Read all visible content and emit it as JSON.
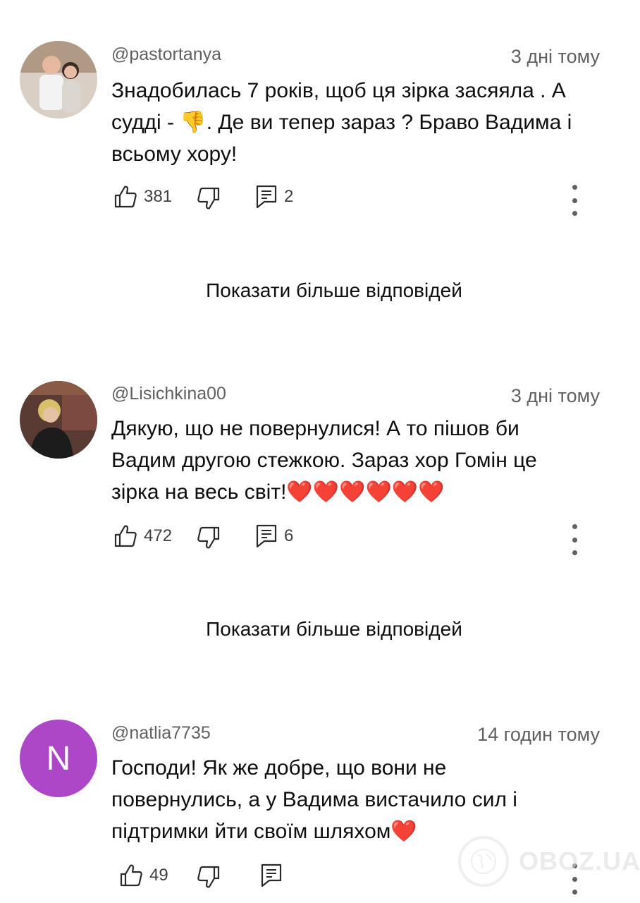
{
  "comments": [
    {
      "handle": "@pastortanya",
      "time": "3 дні тому",
      "lines": [
        "Знадобилась 7 років, щоб ця зірка засяяла . А",
        "судді - 👎. Де ви тепер зараз ? Браво Вадима і",
        "всьому хору!"
      ],
      "likes": "381",
      "replies": "2",
      "avatar": "photo"
    },
    {
      "handle": "@Lisichkina00",
      "time": "3 дні тому",
      "lines": [
        "Дякую, що не повернулися! А то пішов би",
        "Вадим другою стежкою. Зараз хор Гомін це",
        "зірка на весь світ!❤️❤️❤️❤️❤️❤️"
      ],
      "likes": "472",
      "replies": "6",
      "avatar": "photo"
    },
    {
      "handle": "@natlia7735",
      "time": "14 годин тому",
      "lines": [
        "Господи! Як же добре, що вони не",
        "повернулись, а у Вадима вистачило сил і",
        "підтримки йти своїм шляхом❤️"
      ],
      "likes": "49",
      "replies": "",
      "avatar_letter": "N"
    }
  ],
  "show_more_label": "Показати більше відповідей",
  "watermark": "OBOZ.UA",
  "colors": {
    "letter_avatar": "#ad46c7",
    "secondary_text": "#606060"
  },
  "icons": [
    "thumb-up-icon",
    "thumb-down-icon",
    "reply-comment-icon",
    "more-vertical-icon"
  ]
}
